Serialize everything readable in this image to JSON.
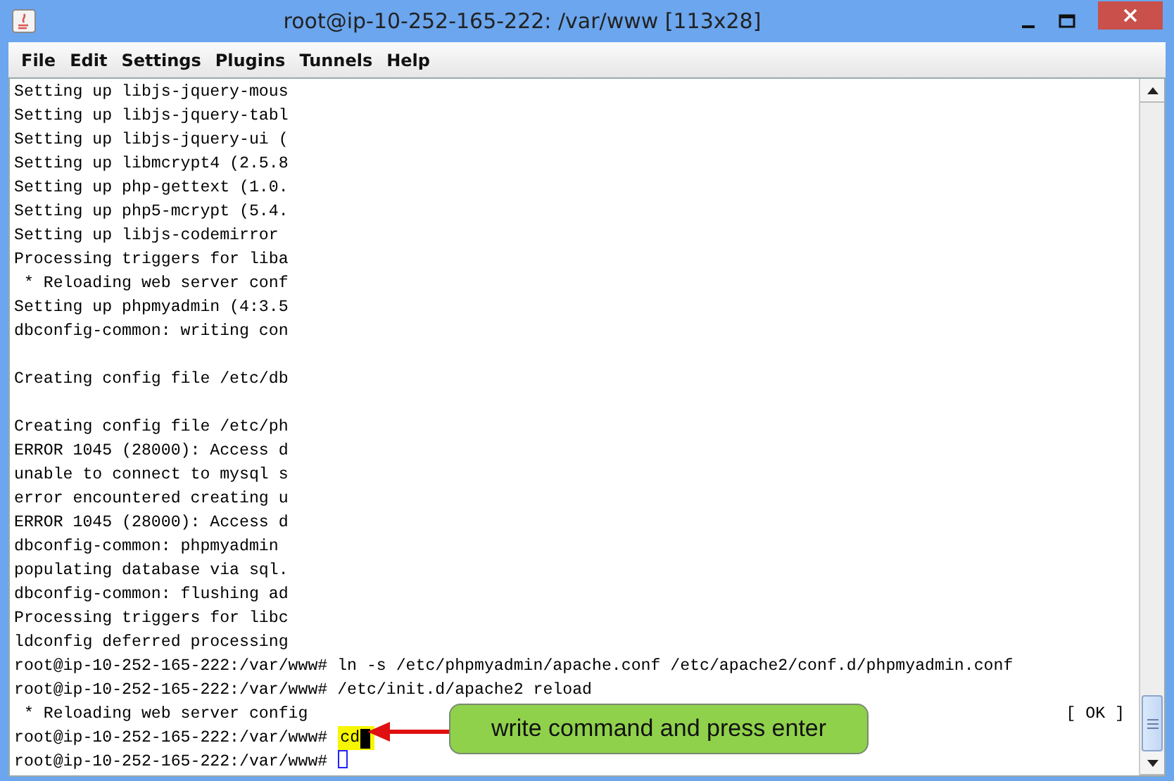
{
  "window": {
    "title": "root@ip-10-252-165-222: /var/www [113x28]"
  },
  "menu": [
    "File",
    "Edit",
    "Settings",
    "Plugins",
    "Tunnels",
    "Help"
  ],
  "terminal": {
    "lines": [
      {
        "kind": "output",
        "text": "Setting up libjs-jquery-mous"
      },
      {
        "kind": "output",
        "text": "Setting up libjs-jquery-tabl"
      },
      {
        "kind": "output",
        "text": "Setting up libjs-jquery-ui ("
      },
      {
        "kind": "output",
        "text": "Setting up libmcrypt4 (2.5.8"
      },
      {
        "kind": "output",
        "text": "Setting up php-gettext (1.0."
      },
      {
        "kind": "output",
        "text": "Setting up php5-mcrypt (5.4."
      },
      {
        "kind": "output",
        "text": "Setting up libjs-codemirror"
      },
      {
        "kind": "output",
        "text": "Processing triggers for liba"
      },
      {
        "kind": "output",
        "text": " * Reloading web server conf"
      },
      {
        "kind": "output",
        "text": "Setting up phpmyadmin (4:3.5"
      },
      {
        "kind": "output",
        "text": "dbconfig-common: writing con"
      },
      {
        "kind": "blank"
      },
      {
        "kind": "output",
        "text": "Creating config file /etc/db"
      },
      {
        "kind": "blank"
      },
      {
        "kind": "output",
        "text": "Creating config file /etc/ph"
      },
      {
        "kind": "output",
        "text": "ERROR 1045 (28000): Access d"
      },
      {
        "kind": "output",
        "text": "unable to connect to mysql s"
      },
      {
        "kind": "output",
        "text": "error encountered creating u"
      },
      {
        "kind": "output",
        "text": "ERROR 1045 (28000): Access d"
      },
      {
        "kind": "output",
        "text": "dbconfig-common: phpmyadmin"
      },
      {
        "kind": "output",
        "text": "populating database via sql."
      },
      {
        "kind": "output",
        "text": "dbconfig-common: flushing ad"
      },
      {
        "kind": "output",
        "text": "Processing triggers for libc"
      },
      {
        "kind": "output",
        "text": "ldconfig deferred processing"
      },
      {
        "kind": "output",
        "text": "root@ip-10-252-165-222:/var/www# ln -s /etc/phpmyadmin/apache.conf /etc/apache2/conf.d/phpmyadmin.conf"
      },
      {
        "kind": "output",
        "text": "root@ip-10-252-165-222:/var/www# /etc/init.d/apache2 reload"
      },
      {
        "kind": "status",
        "text": " * Reloading web server config",
        "status": "[ OK ]"
      },
      {
        "kind": "input",
        "prompt": "root@ip-10-252-165-222:/var/www#",
        "typed": "cd",
        "highlighted": true,
        "cursor_solid": true
      },
      {
        "kind": "input",
        "prompt": "root@ip-10-252-165-222:/var/www#",
        "highlighted": false,
        "cursor_solid": false
      }
    ]
  },
  "callout": {
    "text": "write command and press enter"
  }
}
